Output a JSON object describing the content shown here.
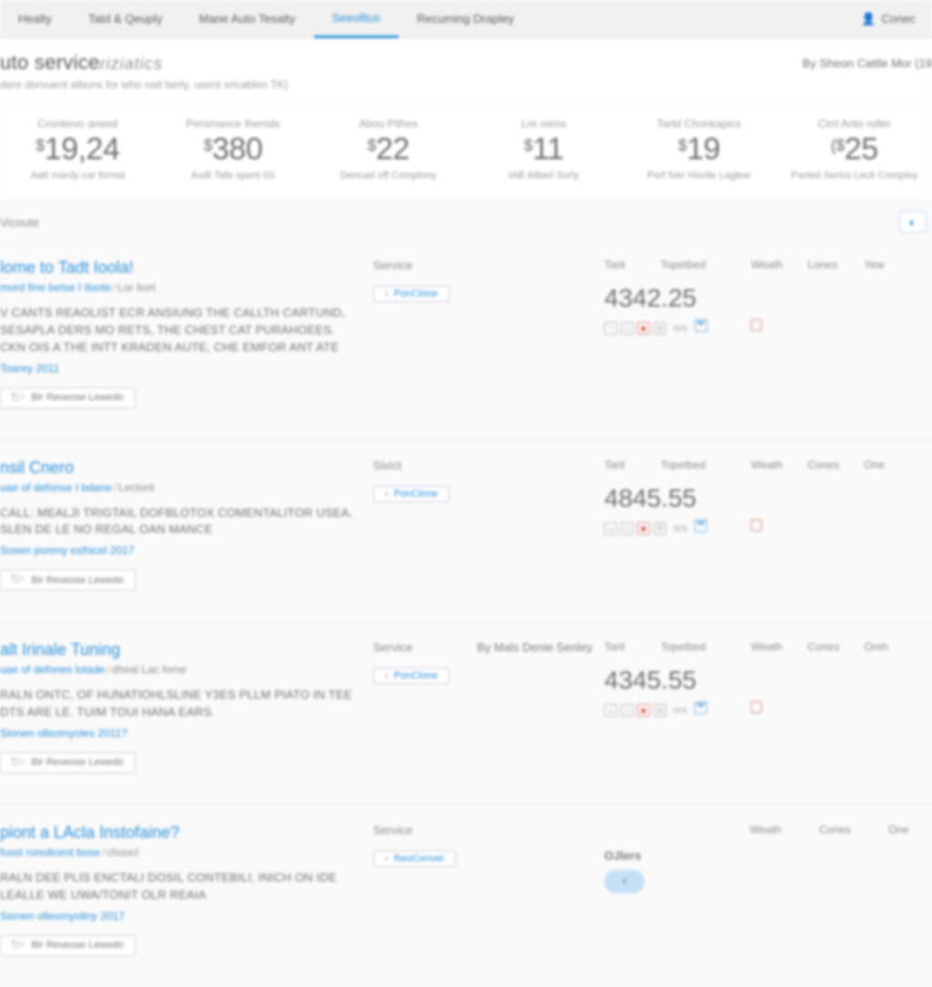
{
  "nav": {
    "items": [
      {
        "label": "Healty"
      },
      {
        "label": "Tatd & Qeuply"
      },
      {
        "label": "Mane Auto Tesalty"
      },
      {
        "label": "Seeolltus",
        "active": true
      },
      {
        "label": "Recuming Drapley"
      }
    ],
    "user": "Conec"
  },
  "header": {
    "title_a": "uto service",
    "title_b": "riziatics",
    "subtitle": "dare dorvuent albuns for who nait berly, usent sricablen TK)",
    "byline": "By Sheon Cattle Mor (19"
  },
  "stats": [
    {
      "label": "Crontievo aneed",
      "cur": "$",
      "value": "19,24",
      "footer": "Aatt mardy car forred"
    },
    {
      "label": "Persmance Ihemds",
      "cur": "$",
      "value": "380",
      "footer": "Audt Tafe spent IIS"
    },
    {
      "label": "Abou Pithes",
      "cur": "$",
      "value": "22",
      "footer": "Dencad off Complony"
    },
    {
      "label": "Lre osms",
      "cur": "$",
      "value": "11",
      "footer": "IAB itdbeil Sorly"
    },
    {
      "label": "Tartd Chonkapics",
      "cur": "$",
      "value": "19",
      "footer": "Porf fver Hoctle Laglew"
    },
    {
      "label": "Cirrt Anto ndler",
      "cur": "($",
      "value": "25",
      "footer": "Parted Serics Leck Compley"
    }
  ],
  "section": {
    "title": "Vicoute"
  },
  "cols": [
    "Tarit",
    "Topetbed",
    "Weath",
    "Lones",
    "Yew"
  ],
  "cols2": [
    "Tarit",
    "Topetbed",
    "Weath",
    "Cones",
    "One"
  ],
  "cols3": [
    "Tarit",
    "Topetbed",
    "Weath",
    "Cones",
    "Oreh"
  ],
  "cols4": [
    "Weath",
    "Cones",
    "One"
  ],
  "svc": "Service",
  "svc2": "Sivict",
  "chip": "PonClone",
  "chip2": "ReoConver",
  "action": "Bir Reveose Lewedo",
  "cards": [
    {
      "title": "lome to Tadt Ioola!",
      "crumb_a": "mord fine betse I tloote",
      "crumb_b": "Lor bort",
      "desc": "V CANTS REAOLIST ECR ANSIUNG THE CALLTH CARTUND, SESAPLA DERS MO RETS, THE CHEST CAT PURAHOEES. CKN OIS A THE INTT KRADEN AUTE, CHE EMFOR ANT ATE",
      "meta": "Toarey 2011",
      "amount": "4342.25",
      "ors": "ors"
    },
    {
      "title": "nsil Cnero",
      "crumb_a": "uae of defonse I bdane",
      "crumb_b": "Lectont",
      "desc": "CALL: MEALJI TRIGTAIL DOFBLOTOX COMENTALITOR USEA. SLEN DE LE NO REGAL OAN MANCE",
      "meta": "Sosen poreny exlhicel 2017",
      "amount": "4845.55",
      "ors": "ors"
    },
    {
      "title": "alt Irinale Tuning",
      "crumb_a": "uae of defones lotade",
      "crumb_b": "dheal Lac fome",
      "byline": "By Mals Denie Senley",
      "desc": "RALN ONTC, OF HUNATIOHLSLINE Y3ES PLLM PIATO IN TEE DTS ARE LE. TUIM TOUI HANA EARS.",
      "meta": "Sionen olleomyoles 2011?",
      "amount": "4345.55",
      "ors": "ors"
    },
    {
      "title": "piont a LAcla Instofaine?",
      "crumb_a": "fusst ronolicent bose",
      "crumb_b": "choocl",
      "desc": "RALN DEE PLIS ENCTALI DOSIL CONTEBILI, INICH ON IDE LEALLE WE UWA/TONIT OLR REAIA",
      "meta": "Sionen olleomyoliny 2017",
      "offers": "OJlers"
    }
  ]
}
